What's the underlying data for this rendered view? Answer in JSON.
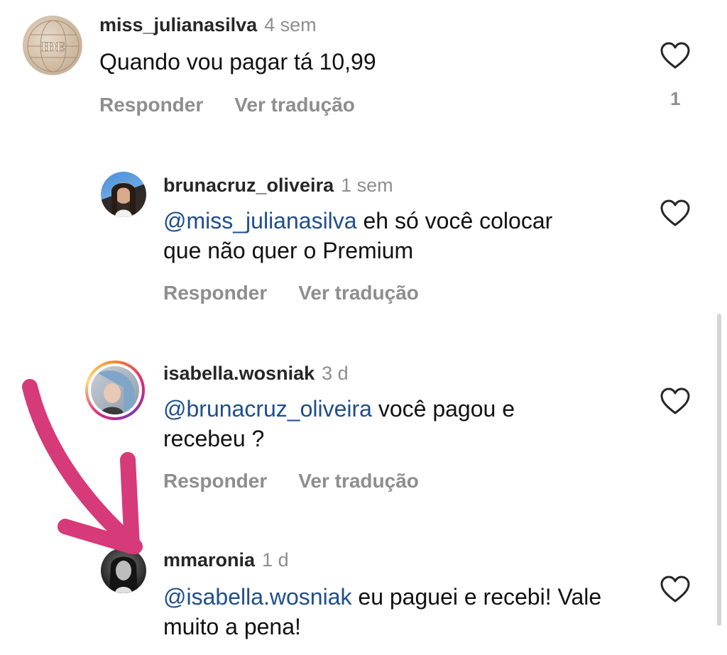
{
  "comments": [
    {
      "username": "miss_julianasilva",
      "time": "4 sem",
      "mention": "",
      "text": "Quando vou pagar tá 10,99",
      "reply_label": "Responder",
      "translate_label": "Ver tradução",
      "likes": "1",
      "avatar_text": "IDE"
    },
    {
      "username": "brunacruz_oliveira",
      "time": "1 sem",
      "mention": "@miss_julianasilva",
      "text": " eh só você colocar que não quer o Premium",
      "reply_label": "Responder",
      "translate_label": "Ver tradução"
    },
    {
      "username": "isabella.wosniak",
      "time": "3 d",
      "mention": "@brunacruz_oliveira",
      "text": " você pagou e recebeu ?",
      "reply_label": "Responder",
      "translate_label": "Ver tradução"
    },
    {
      "username": "mmaronia",
      "time": "1 d",
      "mention": "@isabella.wosniak",
      "text": " eu paguei e recebi! Vale muito a pena!"
    }
  ],
  "colors": {
    "mention": "#1f4e8c",
    "muted": "#8e8e8e",
    "annotation_arrow": "#d63a78"
  },
  "icons": [
    "heart-icon",
    "scrollbar"
  ]
}
